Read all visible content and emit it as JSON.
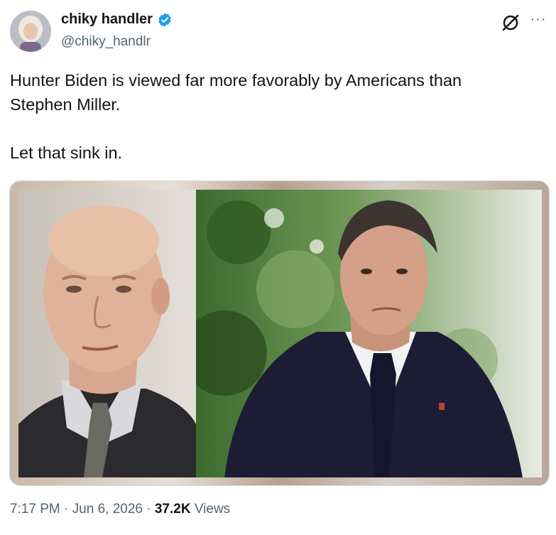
{
  "author": {
    "display_name": "chiky handler",
    "handle": "@chiky_handlr",
    "verified": true,
    "verified_icon": "verified-badge-icon",
    "avatar_icon": "avatar"
  },
  "tweet": {
    "lines": [
      "Hunter Biden is viewed far more favorably by Americans than",
      "Stephen Miller.",
      "Let that sink in."
    ]
  },
  "header_actions": {
    "grok_icon": "grok-icon",
    "more_icon": "more-options-icon",
    "more_label": "···"
  },
  "meta": {
    "time": "7:17 PM",
    "separator": "·",
    "date": "Jun 6, 2026",
    "views_count": "37.2K",
    "views_label": "Views"
  },
  "colors": {
    "accent": "#1d9bf0",
    "text_primary": "#0f1419",
    "text_secondary": "#536471",
    "border": "#cfd9de"
  }
}
